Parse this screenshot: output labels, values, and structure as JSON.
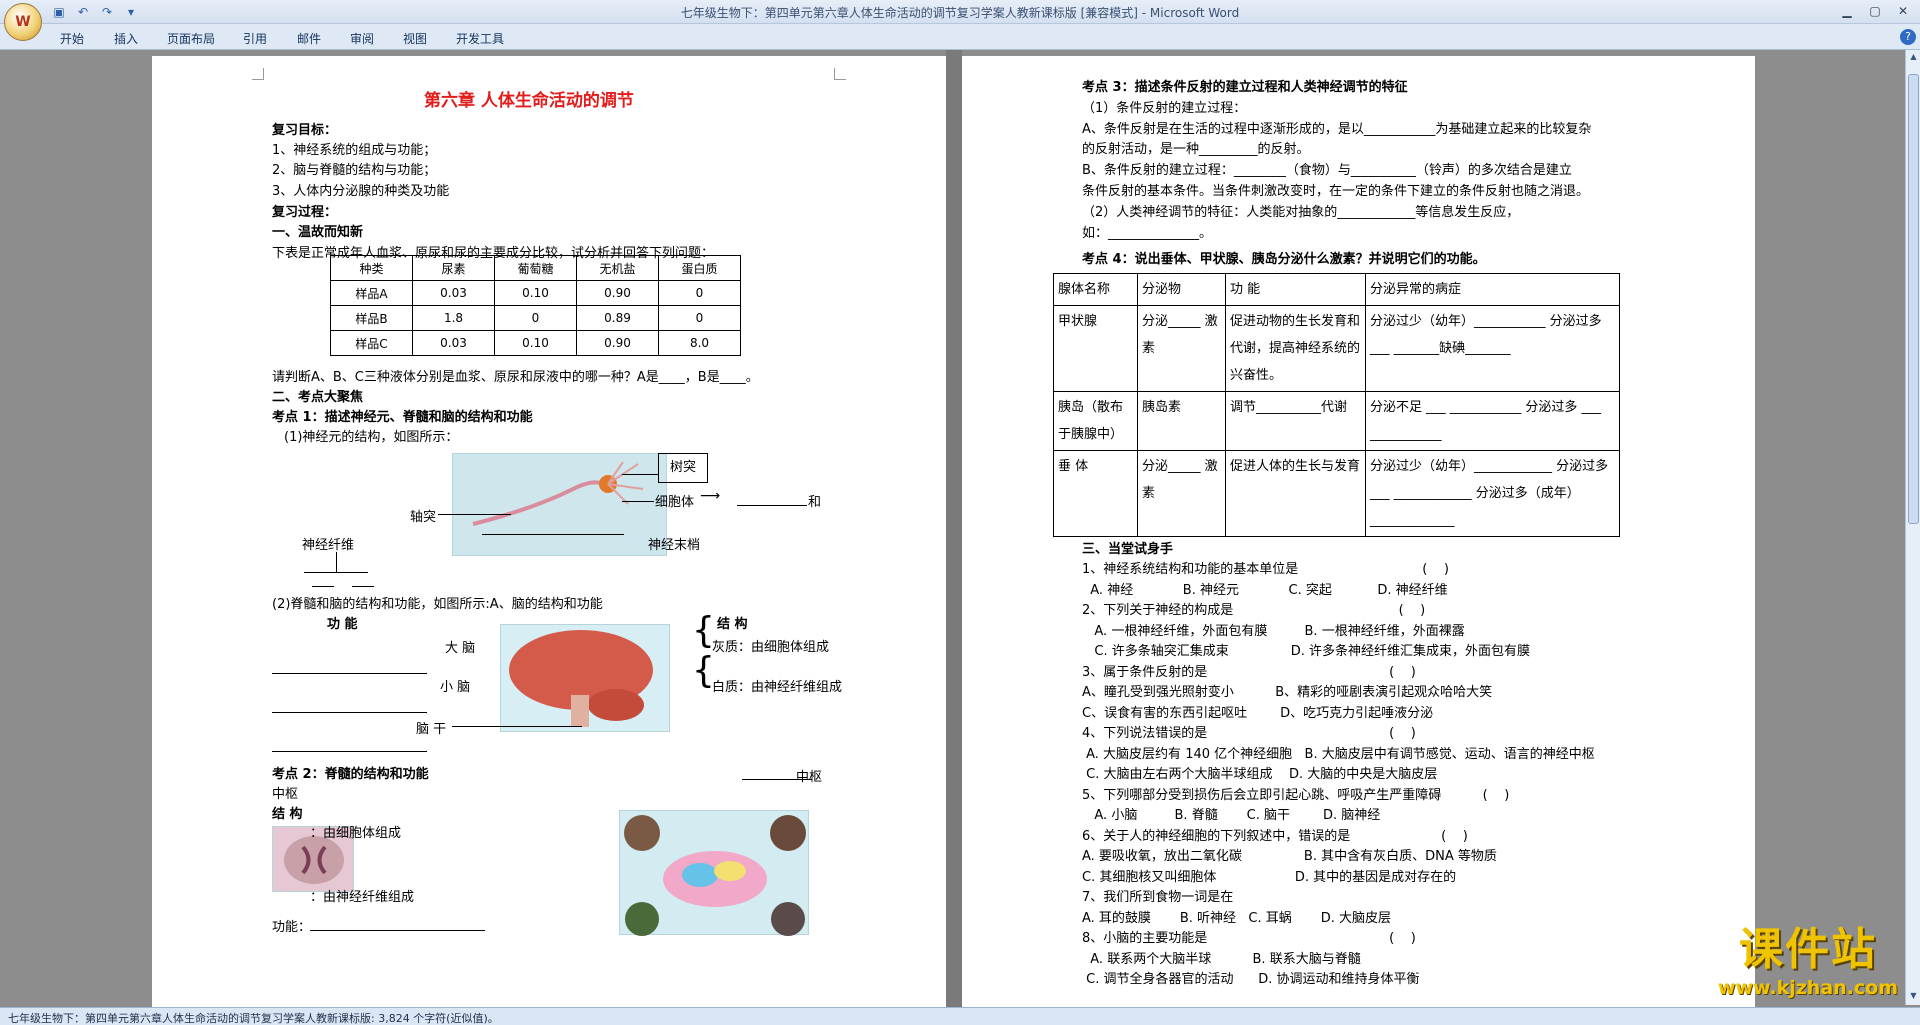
{
  "window": {
    "title": "七年级生物下：第四单元第六章人体生命活动的调节复习学案人教新课标版 [兼容模式] - Microsoft Word",
    "orb_text": "W"
  },
  "menu": [
    "开始",
    "插入",
    "页面布局",
    "引用",
    "邮件",
    "审阅",
    "视图",
    "开发工具"
  ],
  "page1": {
    "title": "第六章  人体生命活动的调节",
    "goals_heading": "复习目标：",
    "goals": [
      "1、神经系统的组成与功能；",
      "2、脑与脊髓的结构与功能；",
      "3、人体内分泌腺的种类及功能"
    ],
    "process_heading": "复习过程：",
    "sec1": "一、温故而知新",
    "table_intro": "下表是正常成年人血浆、原尿和尿的主要成分比较，试分析并回答下列问题：",
    "table_headers": [
      "种类",
      "尿素",
      "葡萄糖",
      "无机盐",
      "蛋白质"
    ],
    "table_rows": [
      [
        "样品A",
        "0.03",
        "0.10",
        "0.90",
        "0"
      ],
      [
        "样品B",
        "1.8",
        "0",
        "0.89",
        "0"
      ],
      [
        "样品C",
        "0.03",
        "0.10",
        "0.90",
        "8.0"
      ]
    ],
    "question_abc": "请判断A、B、C三种液体分别是血浆、原尿和尿液中的哪一种？A是____，B是____。",
    "sec2": "二、考点大聚焦",
    "kp1": "考点 1：描述神经元、脊髓和脑的结构和功能",
    "kp1_sub1": "(1)神经元的结构，如图所示：",
    "neuron_labels": {
      "dendrite": "树突",
      "cell_body": "细胞体",
      "axon": "轴突",
      "fiber": "神经纤维",
      "ending": "神经末梢",
      "and": "和"
    },
    "kp1_sub2": "(2)脊髓和脑的结构和功能，如图所示:A、脑的结构和功能",
    "brain_labels": {
      "function": "功  能",
      "structure": "结  构",
      "cerebrum": "大  脑",
      "cerebellum": "小  脑",
      "brainstem": "脑  干",
      "gray": "灰质：由细胞体组成",
      "white": "白质：由神经纤维组成"
    },
    "kp2": "考点  2：脊髓的结构和功能",
    "kp2_center": "中枢",
    "kp2_structure": "结  构",
    "spinal_gray": "：由细胞体组成",
    "spinal_white": "：由神经纤维组成",
    "spinal_func": "功能：",
    "centers": [
      "中枢",
      "中枢",
      "中枢"
    ]
  },
  "page2": {
    "kp3": "考点 3：描述条件反射的建立过程和人类神经调节的特征",
    "kp3_sub1": "（1）条件反射的建立过程：",
    "kp3_a1": "A、条件反射是在生活的过程中逐渐形成的，是以___________为基础建立起来的比较复杂",
    "kp3_a2": "的反射活动，是一种_________的反射。",
    "kp3_b1": "B、条件反射的建立过程：________（食物）与__________（铃声）的多次结合是建立",
    "kp3_b2": "条件反射的基本条件。当条件刺激改变时，在一定的条件下建立的条件反射也随之消退。",
    "kp3_c1": "（2）人类神经调节的特征：人类能对抽象的____________等信息发生反应，",
    "kp3_c2": "如：______________。",
    "kp4": "考点 4：说出垂体、甲状腺、胰岛分泌什么激素？并说明它们的功能。",
    "table_headers": [
      "腺体名称",
      "分泌物",
      "功    能",
      "分泌异常的病症"
    ],
    "table_rows": [
      [
        "甲状腺",
        "分泌_____ 激素",
        "促进动物的生长发育和代谢，提高神经系统的兴奋性。",
        "分泌过少（幼年）___________ 分泌过多 ___ _______缺碘_______"
      ],
      [
        "胰岛（散布于胰腺中）",
        "胰岛素",
        "调节__________代谢",
        "分泌不足 ___ ___________ 分泌过多 ___ ___________"
      ],
      [
        "垂  体",
        "分泌_____ 激素",
        "促进人体的生长与发育",
        "分泌过少（幼年）____________ 分泌过多 ___ ____________ 分泌过多（成年）_____________"
      ]
    ],
    "sec3": "三、当堂试身手",
    "questions": [
      "1、神经系统结构和功能的基本单位是                              (    )",
      "  A. 神经            B. 神经元            C. 突起           D. 神经纤维",
      "2、下列关于神经的构成是                                        (    )",
      "   A. 一根神经纤维，外面包有膜         B. 一根神经纤维，外面裸露",
      "   C. 许多条轴突汇集成束               D. 许多条神经纤维汇集成束，外面包有膜",
      "3、属于条件反射的是                                            (    )",
      "A、瞳孔受到强光照射变小          B、精彩的哑剧表演引起观众哈哈大笑",
      "C、误食有害的东西引起呕吐        D、吃巧克力引起唾液分泌",
      "4、下列说法错误的是                                            (    )",
      " A. 大脑皮层约有 140 亿个神经细胞   B. 大脑皮层中有调节感觉、运动、语言的神经中枢",
      " C. 大脑由左右两个大脑半球组成    D. 大脑的中央是大脑皮层",
      "5、下列哪部分受到损伤后会立即引起心跳、呼吸产生严重障碍          (    )",
      "   A. 小脑         B. 脊髓       C. 脑干        D. 脑神经",
      "6、关于人的神经细胞的下列叙述中，错误的是                      (    )",
      "A. 要吸收氧，放出二氧化碳               B. 其中含有灰白质、DNA 等物质",
      "C. 其细胞核又叫细胞体                   D. 其中的基因是成对存在的",
      "7、我们所到食物一词是在",
      "A. 耳的鼓膜       B. 听神经   C. 耳蜗       D. 大脑皮层",
      "8、小脑的主要功能是                                            (    )",
      "  A. 联系两个大脑半球          B. 联系大脑与脊髓",
      " C. 调节全身各器官的活动      D. 协调运动和维持身体平衡"
    ]
  },
  "status": "七年级生物下：第四单元第六章人体生命活动的调节复习学案人教新课标版: 3,824 个字符(近似值)。",
  "watermark": {
    "cn": "课件站",
    "url": "www.kjzhan.com"
  }
}
